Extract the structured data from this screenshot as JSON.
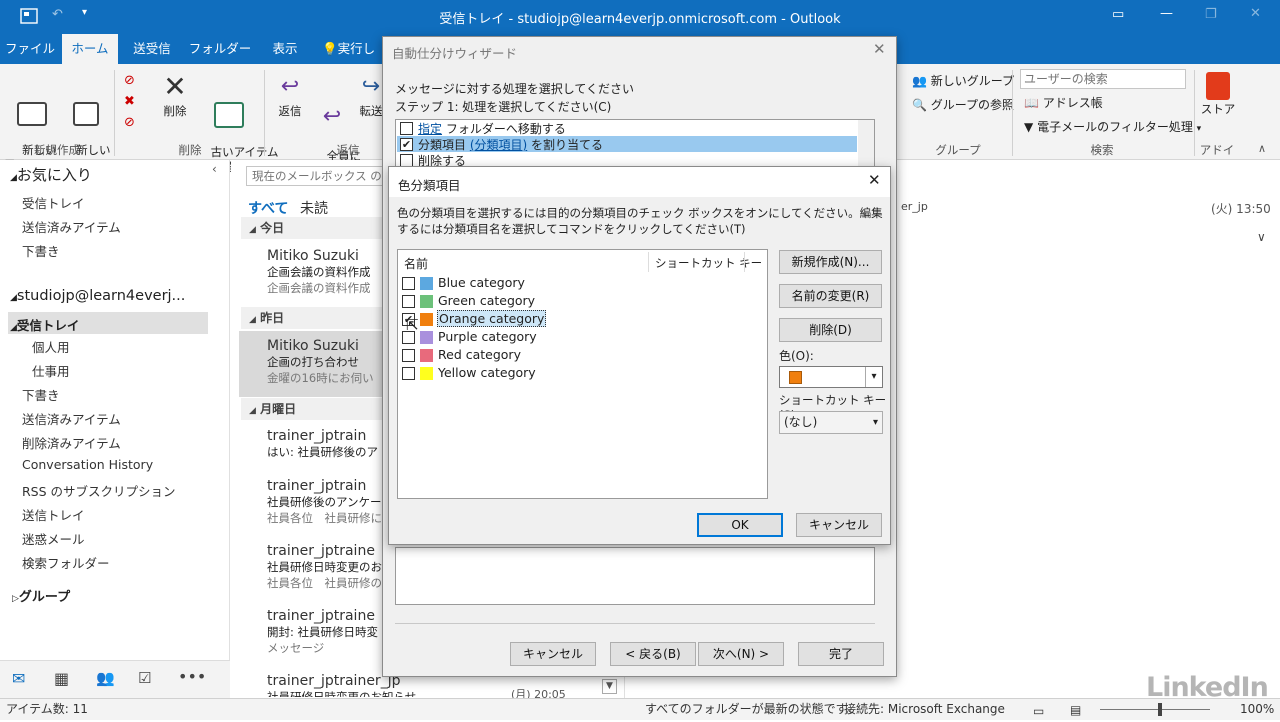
{
  "window": {
    "title": "受信トレイ - studiojp@learn4everjp.onmicrosoft.com - Outlook"
  },
  "menu": {
    "tabs": [
      "ファイル",
      "ホーム",
      "送受信",
      "フォルダー",
      "表示",
      "実行した"
    ]
  },
  "ribbon": {
    "new_email": "新しい\n電子メール",
    "new_items": "新しい\nアイテム",
    "delete": "削除",
    "clean_up": "古いアイテム\nの整理",
    "reply": "返信",
    "reply_all": "全員に\n返信",
    "forward": "転送",
    "new_group": "新しいグループ",
    "browse_groups": "グループの参照",
    "search_people_placeholder": "ユーザーの検索",
    "address_book": "アドレス帳",
    "filter_email": "電子メールのフィルター処理",
    "store": "ストア",
    "groups": {
      "new": "新規作成",
      "delete": "削除",
      "respond": "返信",
      "group": "グループ",
      "find": "検索",
      "addins": "アドイン"
    }
  },
  "nav": {
    "favorites": "お気に入り",
    "fav_items": [
      "受信トレイ",
      "送信済みアイテム",
      "下書き"
    ],
    "account": "studiojp@learn4everj...",
    "inbox": "受信トレイ",
    "subfolders": [
      "個人用",
      "仕事用"
    ],
    "folders": [
      "下書き",
      "送信済みアイテム",
      "削除済みアイテム",
      "Conversation History",
      "RSS のサブスクリプション",
      "送信トレイ",
      "迷惑メール",
      "検索フォルダー"
    ],
    "groups": "グループ"
  },
  "mail": {
    "search_placeholder": "現在のメールボックス の検索",
    "filter_all": "すべて",
    "filter_unread": "未読",
    "sections": [
      "今日",
      "昨日",
      "月曜日"
    ],
    "items": [
      {
        "from": "Mitiko Suzuki",
        "subject": "企画会議の資料作成",
        "preview": "企画会議の資料作成"
      },
      {
        "from": "Mitiko Suzuki",
        "subject": "企画の打ち合わせ",
        "preview": "金曜の16時にお伺い"
      },
      {
        "from": "trainer_jptrain",
        "subject": "はい: 社員研修後のア",
        "preview": ""
      },
      {
        "from": "trainer_jptrain",
        "subject": "社員研修後のアンケー",
        "preview": "社員各位　社員研修に"
      },
      {
        "from": "trainer_jptraine",
        "subject": "社員研修日時変更のお",
        "preview": "社員各位　社員研修の"
      },
      {
        "from": "trainer_jptraine",
        "subject": "開封: 社員研修日時変",
        "preview": "メッセージ"
      },
      {
        "from": "trainer_jptrainer_jp",
        "subject": "社員研修日時変更のお知らせ",
        "preview": ""
      }
    ],
    "last_time": "(月) 20:05"
  },
  "reading": {
    "sender_fragment": "er_jp",
    "date": "(火) 13:50"
  },
  "wizard": {
    "title": "自動仕分けウィザード",
    "prompt": "メッセージに対する処理を選択してください",
    "step1": "ステップ 1: 処理を選択してください(C)",
    "actions": [
      {
        "pre": "",
        "link": "指定",
        "post": " フォルダーへ移動する",
        "checked": false
      },
      {
        "pre": "分類項目 ",
        "link": "(分類項目)",
        "post": " を割り当てる",
        "checked": true
      },
      {
        "pre": "削除する",
        "link": "",
        "post": "",
        "checked": false
      }
    ],
    "buttons": {
      "cancel": "キャンセル",
      "back": "< 戻る(B)",
      "next": "次へ(N) >",
      "finish": "完了"
    }
  },
  "category_dialog": {
    "title": "色分類項目",
    "instructions": "色の分類項目を選択するには目的の分類項目のチェック ボックスをオンにしてください。編集するには分類項目名を選択してコマンドをクリックしてください(T)",
    "col_name": "名前",
    "col_shortcut": "ショートカット キー",
    "categories": [
      {
        "name": "Blue category",
        "color": "#5ca8e0",
        "checked": false
      },
      {
        "name": "Green category",
        "color": "#6cc17a",
        "checked": false
      },
      {
        "name": "Orange category",
        "color": "#f07f0e",
        "checked": true
      },
      {
        "name": "Purple category",
        "color": "#a990dd",
        "checked": false
      },
      {
        "name": "Red category",
        "color": "#e86a7c",
        "checked": false
      },
      {
        "name": "Yellow category",
        "color": "#ffff1e",
        "checked": false
      }
    ],
    "new_button": "新規作成(N)...",
    "rename_button": "名前の変更(R)",
    "delete_button": "削除(D)",
    "color_label": "色(O):",
    "selected_color": "#f07f0e",
    "shortcut_label": "ショートカット キー(S):",
    "shortcut_value": "(なし)",
    "ok": "OK",
    "cancel": "キャンセル"
  },
  "status": {
    "item_count": "アイテム数: 11",
    "sync": "すべてのフォルダーが最新の状態です。",
    "connection": "接続先: Microsoft Exchange",
    "zoom": "100%"
  },
  "watermark": "LinkedIn"
}
